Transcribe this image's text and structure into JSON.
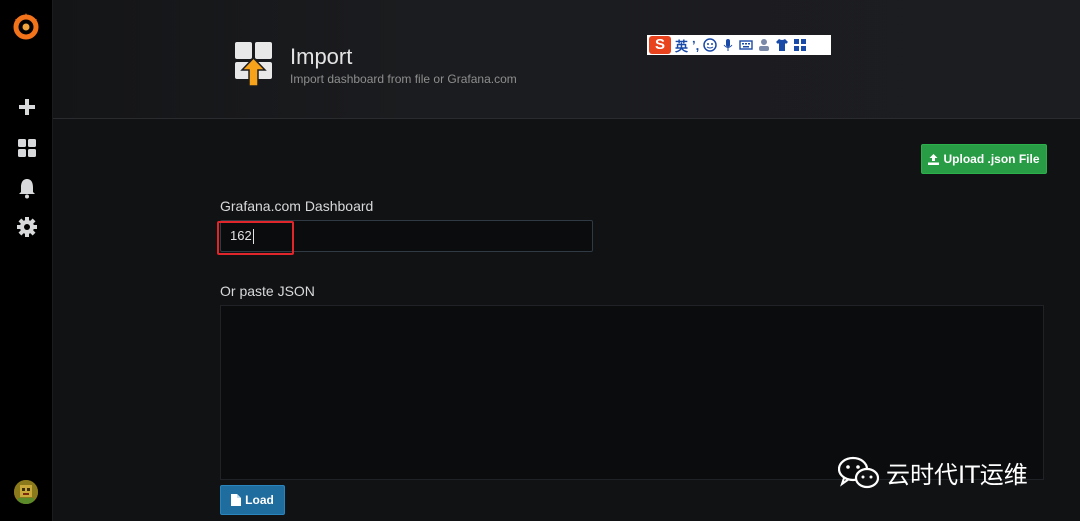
{
  "header": {
    "title": "Import",
    "subtitle": "Import dashboard from file or Grafana.com"
  },
  "ime_bar": {
    "lang": "英",
    "punct": "ʼ,"
  },
  "upload_button": {
    "label": "Upload .json File",
    "icon": "upload-icon"
  },
  "grafana_field": {
    "label": "Grafana.com Dashboard",
    "value": "162"
  },
  "json_field": {
    "label": "Or paste JSON",
    "value": ""
  },
  "load_button": {
    "label": "Load",
    "icon": "file-icon"
  },
  "watermark": {
    "text": "云时代IT运维"
  },
  "sidebar": {
    "items": [
      {
        "icon": "grafana-logo-icon"
      },
      {
        "icon": "plus-icon"
      },
      {
        "icon": "dashboards-icon"
      },
      {
        "icon": "bell-icon"
      },
      {
        "icon": "gear-icon"
      },
      {
        "icon": "user-avatar"
      }
    ]
  },
  "colors": {
    "accent_green": "#299c46",
    "accent_blue": "#1f6c9e",
    "highlight_red": "#e0262a",
    "logo_orange": "#f3731b"
  }
}
